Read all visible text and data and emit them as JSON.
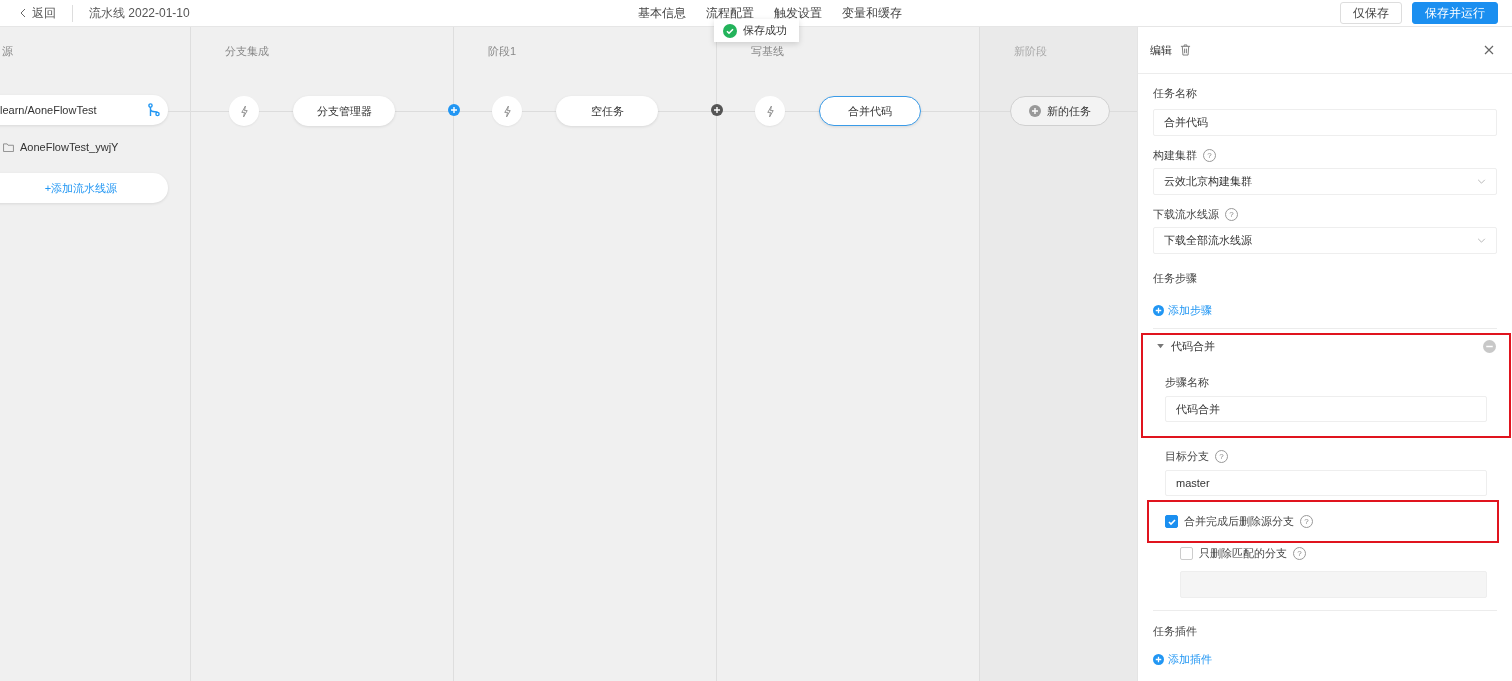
{
  "header": {
    "back": "返回",
    "title": "流水线 2022-01-10",
    "tabs": [
      {
        "label": "基本信息"
      },
      {
        "label": "流程配置"
      },
      {
        "label": "触发设置"
      },
      {
        "label": "变量和缓存"
      }
    ],
    "buttons": [
      {
        "label": "仅保存",
        "kind": "default"
      },
      {
        "label": "保存并运行",
        "kind": "primary"
      }
    ]
  },
  "toast": {
    "text": "保存成功"
  },
  "source": {
    "heading": "源",
    "repo": "learn/AoneFlowTest",
    "folder": "AoneFlowTest_ywjY",
    "add_icon": "+",
    "add": "添加流水线源"
  },
  "stages": [
    {
      "name": "分支集成",
      "kind": "stage",
      "job": {
        "label": "分支管理器",
        "selected": false
      },
      "add_button": {
        "active": true
      }
    },
    {
      "name": "阶段1",
      "kind": "stage",
      "job": {
        "label": "空任务",
        "selected": false
      },
      "add_button": {
        "active": false
      }
    },
    {
      "name": "写基线",
      "kind": "stage",
      "job": {
        "label": "合并代码",
        "selected": true
      }
    },
    {
      "name": "新阶段",
      "kind": "new",
      "job": {
        "label": "新的任务",
        "selected": false
      }
    }
  ],
  "panel": {
    "title": "编辑",
    "fields": [
      {
        "label": "任务名称",
        "kind": "input",
        "value": "合并代码"
      },
      {
        "label": "构建集群",
        "kind": "select",
        "help": "?",
        "value": "云效北京构建集群"
      },
      {
        "label": "下载流水线源",
        "kind": "select",
        "help": "?",
        "value": "下载全部流水线源"
      }
    ],
    "steps_heading": "任务步骤",
    "add_step": "添加步骤",
    "step": {
      "title": "代码合并",
      "expanded": true,
      "highlighted": true,
      "name_label": "步骤名称",
      "name_value": "代码合并",
      "branch_label": "目标分支",
      "branch_help": "?",
      "branch_value": "master",
      "checks": [
        {
          "label": "合并完成后删除源分支",
          "help": "?",
          "checked": true,
          "highlighted": true
        },
        {
          "label": "只删除匹配的分支",
          "help": "?",
          "checked": false,
          "highlighted": false
        }
      ]
    },
    "plugins_heading": "任务插件",
    "add_plugin": "添加插件"
  }
}
